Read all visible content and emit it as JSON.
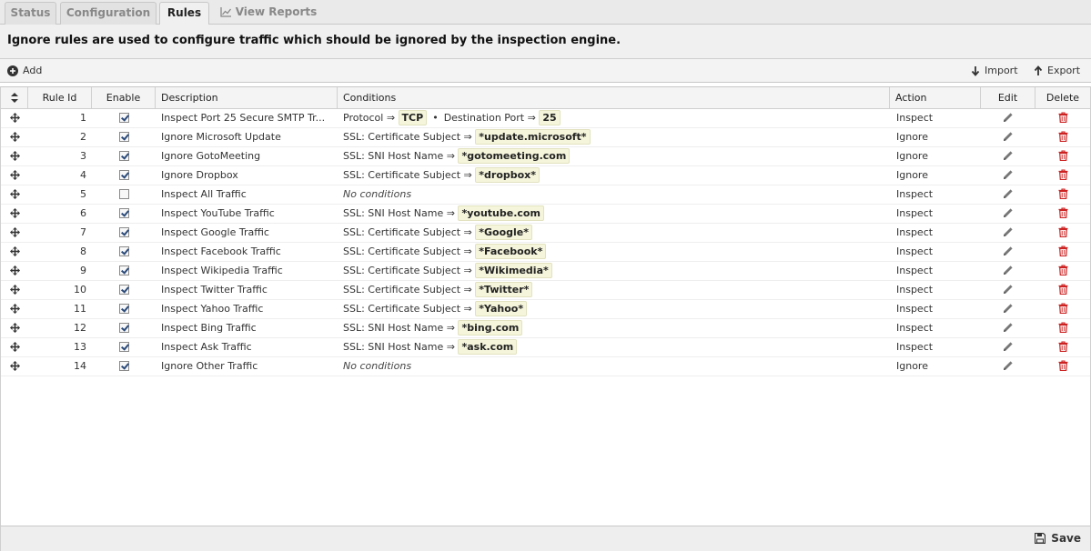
{
  "tabs": [
    {
      "label": "Status"
    },
    {
      "label": "Configuration"
    },
    {
      "label": "Rules"
    },
    {
      "label": "View Reports"
    }
  ],
  "info_text": "Ignore rules are used to configure traffic which should be ignored by the inspection engine.",
  "toolbar": {
    "add_label": "Add",
    "import_label": "Import",
    "export_label": "Export"
  },
  "columns": {
    "rule_id": "Rule Id",
    "enable": "Enable",
    "description": "Description",
    "conditions": "Conditions",
    "action": "Action",
    "edit": "Edit",
    "delete": "Delete"
  },
  "rules": [
    {
      "id": "1",
      "enabled": true,
      "description": "Inspect Port 25 Secure SMTP Tr...",
      "conditions": [
        {
          "label": "Protocol ⇒",
          "value": "TCP"
        },
        {
          "label": "Destination Port ⇒",
          "value": "25"
        }
      ],
      "action": "Inspect"
    },
    {
      "id": "2",
      "enabled": true,
      "description": "Ignore Microsoft Update",
      "conditions": [
        {
          "label": "SSL: Certificate Subject ⇒",
          "value": "*update.microsoft*"
        }
      ],
      "action": "Ignore"
    },
    {
      "id": "3",
      "enabled": true,
      "description": "Ignore GotoMeeting",
      "conditions": [
        {
          "label": "SSL: SNI Host Name ⇒",
          "value": "*gotomeeting.com"
        }
      ],
      "action": "Ignore"
    },
    {
      "id": "4",
      "enabled": true,
      "description": "Ignore Dropbox",
      "conditions": [
        {
          "label": "SSL: Certificate Subject ⇒",
          "value": "*dropbox*"
        }
      ],
      "action": "Ignore"
    },
    {
      "id": "5",
      "enabled": false,
      "description": "Inspect All Traffic",
      "no_conditions": "No conditions",
      "conditions": [],
      "action": "Inspect"
    },
    {
      "id": "6",
      "enabled": true,
      "description": "Inspect YouTube Traffic",
      "conditions": [
        {
          "label": "SSL: SNI Host Name ⇒",
          "value": "*youtube.com"
        }
      ],
      "action": "Inspect"
    },
    {
      "id": "7",
      "enabled": true,
      "description": "Inspect Google Traffic",
      "conditions": [
        {
          "label": "SSL: Certificate Subject ⇒",
          "value": "*Google*"
        }
      ],
      "action": "Inspect"
    },
    {
      "id": "8",
      "enabled": true,
      "description": "Inspect Facebook Traffic",
      "conditions": [
        {
          "label": "SSL: Certificate Subject ⇒",
          "value": "*Facebook*"
        }
      ],
      "action": "Inspect"
    },
    {
      "id": "9",
      "enabled": true,
      "description": "Inspect Wikipedia Traffic",
      "conditions": [
        {
          "label": "SSL: Certificate Subject ⇒",
          "value": "*Wikimedia*"
        }
      ],
      "action": "Inspect"
    },
    {
      "id": "10",
      "enabled": true,
      "description": "Inspect Twitter Traffic",
      "conditions": [
        {
          "label": "SSL: Certificate Subject ⇒",
          "value": "*Twitter*"
        }
      ],
      "action": "Inspect"
    },
    {
      "id": "11",
      "enabled": true,
      "description": "Inspect Yahoo Traffic",
      "conditions": [
        {
          "label": "SSL: Certificate Subject ⇒",
          "value": "*Yahoo*"
        }
      ],
      "action": "Inspect"
    },
    {
      "id": "12",
      "enabled": true,
      "description": "Inspect Bing Traffic",
      "conditions": [
        {
          "label": "SSL: SNI Host Name ⇒",
          "value": "*bing.com"
        }
      ],
      "action": "Inspect"
    },
    {
      "id": "13",
      "enabled": true,
      "description": "Inspect Ask Traffic",
      "conditions": [
        {
          "label": "SSL: SNI Host Name ⇒",
          "value": "*ask.com"
        }
      ],
      "action": "Inspect"
    },
    {
      "id": "14",
      "enabled": true,
      "description": "Ignore Other Traffic",
      "no_conditions": "No conditions",
      "conditions": [],
      "action": "Ignore"
    }
  ],
  "footer": {
    "save_label": "Save"
  },
  "colors": {
    "delete_icon": "#cc2222",
    "condition_highlight": "#f5f5dc"
  }
}
